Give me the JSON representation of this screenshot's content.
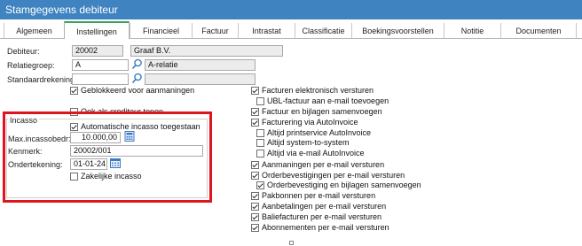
{
  "window": {
    "title": "Stamgegevens debiteur"
  },
  "tabs": [
    {
      "label": "Algemeen"
    },
    {
      "label": "Instellingen"
    },
    {
      "label": "Financieel"
    },
    {
      "label": "Factuur"
    },
    {
      "label": "Intrastat"
    },
    {
      "label": "Classificatie"
    },
    {
      "label": "Boekingsvoorstellen"
    },
    {
      "label": "Notitie"
    },
    {
      "label": "Documenten"
    }
  ],
  "active_tab": "Instellingen",
  "fields": {
    "debiteur": {
      "label": "Debiteur:",
      "code": "20002",
      "name": "Graaf B.V."
    },
    "relatiegroep": {
      "label": "Relatiegroep:",
      "code": "A",
      "name": "A-relatie"
    },
    "standaardrekening": {
      "label": "Standaardrekening:",
      "code": "",
      "name": ""
    }
  },
  "left_checks": [
    {
      "label": "Geblokkeerd voor aanmaningen",
      "checked": true
    },
    {
      "label": "Ook als crediteur tonen",
      "checked": false
    }
  ],
  "incasso": {
    "title": "Incasso",
    "auto_label": "Automatische incasso toegestaan",
    "auto_checked": true,
    "max_label": "Max.incassobedr:",
    "max_value": "10.000,00",
    "kenmerk_label": "Kenmerk:",
    "kenmerk_value": "20002/001",
    "ondertekening_label": "Ondertekening:",
    "ondertekening_value": "01-01-24",
    "zakelijk_label": "Zakelijke incasso",
    "zakelijk_checked": false
  },
  "right_checks": [
    {
      "label": "Facturen elektronisch versturen",
      "checked": true
    },
    {
      "label": "UBL-factuur aan e-mail toevoegen",
      "checked": false
    },
    {
      "label": "Factuur en bijlagen samenvoegen",
      "checked": true
    },
    {
      "label": "Facturering via AutoInvoice",
      "checked": true
    },
    {
      "label": "Altijd printservice AutoInvoice",
      "checked": false
    },
    {
      "label": "Altijd system-to-system",
      "checked": false
    },
    {
      "label": "Altijd via e-mail AutoInvoice",
      "checked": false
    },
    {
      "label": "Aanmaningen per e-mail versturen",
      "checked": true
    },
    {
      "label": "Orderbevestigingen per e-mail versturen",
      "checked": true
    },
    {
      "label": "Orderbevestiging en bijlagen samenvoegen",
      "checked": true
    },
    {
      "label": "Pakbonnen per e-mail versturen",
      "checked": true
    },
    {
      "label": "Aanbetalingen per e-mail versturen",
      "checked": true
    },
    {
      "label": "Baliefacturen per e-mail versturen",
      "checked": true
    },
    {
      "label": "Abonnementen per e-mail versturen",
      "checked": true
    }
  ],
  "colors": {
    "titlebar": "#3f83c0",
    "highlight": "#e0141c",
    "active_tab_accent": "#3aa35a"
  }
}
